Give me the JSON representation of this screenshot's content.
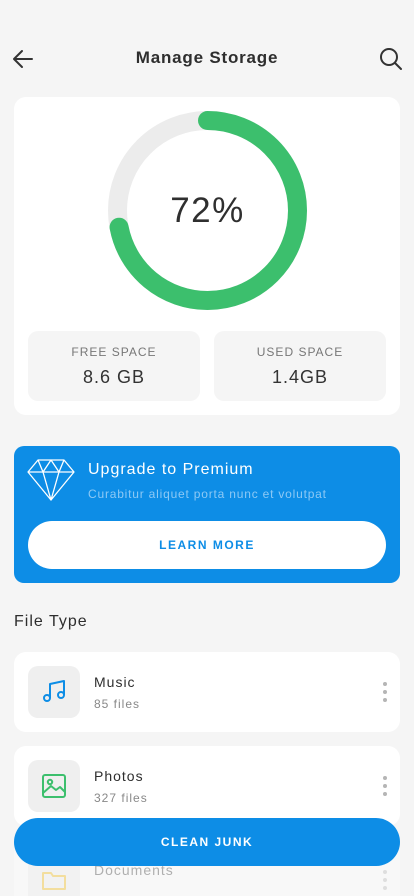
{
  "header": {
    "title": "Manage Storage",
    "back_icon": "arrow-left-icon",
    "search_icon": "search-icon"
  },
  "storage": {
    "used_fraction": 0.72,
    "percent_label": "72%",
    "free_label": "FREE SPACE",
    "free_value": "8.6 GB",
    "used_label": "USED SPACE",
    "used_value": "1.4GB"
  },
  "premium": {
    "icon": "diamond-icon",
    "title": "Upgrade to Premium",
    "subtitle": "Curabitur aliquet porta nunc et volutpat",
    "button_label": "LEARN MORE"
  },
  "file_types": {
    "title": "File Type",
    "items": [
      {
        "name": "Music",
        "count": "85 files",
        "icon": "music-note-icon"
      },
      {
        "name": "Photos",
        "count": "327 files",
        "icon": "image-icon"
      },
      {
        "name": "Documents",
        "count": "",
        "icon": "folder-icon"
      }
    ]
  },
  "actions": {
    "clean_label": "CLEAN JUNK"
  },
  "colors": {
    "accent_blue": "#0d8de6",
    "gauge_green": "#3cbf6d",
    "gauge_track": "#ececec",
    "background": "#f5f5f5"
  }
}
